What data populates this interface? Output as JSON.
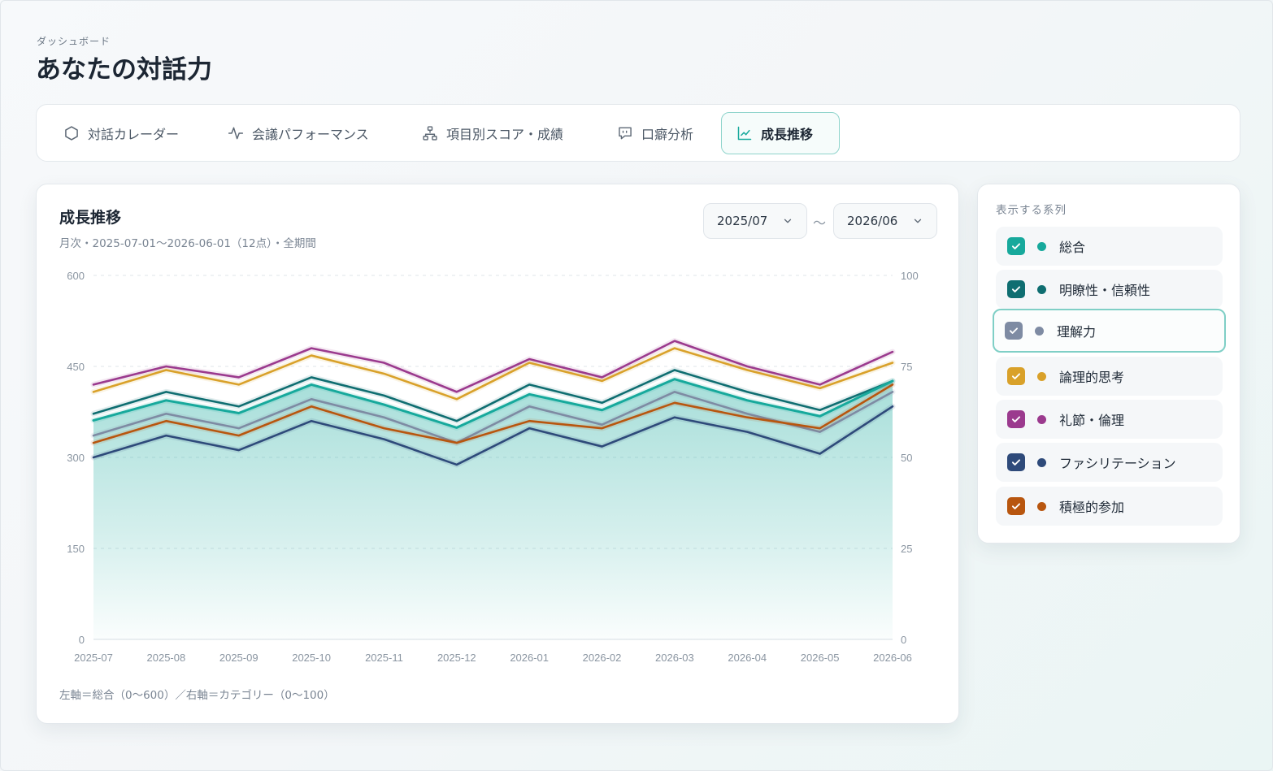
{
  "header": {
    "eyebrow": "ダッシュボード",
    "title": "あなたの対話力"
  },
  "tabs": [
    {
      "label": "対話カレーダー",
      "icon": "hexagon-icon",
      "active": false
    },
    {
      "label": "会議パフォーマンス",
      "icon": "pulse-icon",
      "active": false
    },
    {
      "label": "項目別スコア・成績",
      "icon": "hierarchy-icon",
      "active": false
    },
    {
      "label": "口癖分析",
      "icon": "speech-bubble-icon",
      "active": false
    },
    {
      "label": "成長推移",
      "icon": "line-chart-icon",
      "active": true
    }
  ],
  "card": {
    "title": "成長推移",
    "subtitle": "月次・2025-07-01〜2026-06-01（12点）・全期間",
    "range_from": "2025/07",
    "range_to": "2026/06",
    "range_sep": "〜",
    "footnote": "左軸＝総合（0〜600）／右軸＝カテゴリー（0〜100）"
  },
  "panel": {
    "title": "表示する系列",
    "items": [
      {
        "label": "総合",
        "color": "#17a99c",
        "checked": true
      },
      {
        "label": "明瞭性・信頼性",
        "color": "#0f6e71",
        "checked": true
      },
      {
        "label": "理解力",
        "color": "#7e8ba3",
        "checked": true
      },
      {
        "label": "論理的思考",
        "color": "#d9a12a",
        "checked": true
      },
      {
        "label": "礼節・倫理",
        "color": "#9b3a8e",
        "checked": true
      },
      {
        "label": "ファシリテーション",
        "color": "#2e4a7a",
        "checked": true
      },
      {
        "label": "積極的参加",
        "color": "#b8560f",
        "checked": true
      }
    ]
  },
  "chart_data": {
    "type": "line",
    "x": [
      "2025-07",
      "2025-08",
      "2025-09",
      "2025-10",
      "2025-11",
      "2025-12",
      "2026-01",
      "2026-02",
      "2026-03",
      "2026-04",
      "2026-05",
      "2026-06"
    ],
    "left_axis": {
      "min": 0,
      "max": 600,
      "ticks": [
        0,
        150,
        300,
        450,
        600
      ]
    },
    "right_axis": {
      "min": 0,
      "max": 100,
      "ticks": [
        0,
        25,
        50,
        75,
        100
      ]
    },
    "grid": true,
    "series": [
      {
        "name": "総合",
        "axis": "left",
        "color": "#17a99c",
        "area": true,
        "values": [
          361,
          394,
          373,
          420,
          387,
          349,
          404,
          378,
          429,
          394,
          368,
          426
        ]
      },
      {
        "name": "明瞭性・信頼性",
        "axis": "right",
        "color": "#0f6e71",
        "values": [
          62,
          68,
          64,
          72,
          67,
          60,
          70,
          65,
          74,
          68,
          63,
          71
        ]
      },
      {
        "name": "理解力",
        "axis": "right",
        "color": "#7e8ba3",
        "values": [
          56,
          62,
          58,
          66,
          61,
          54,
          64,
          59,
          68,
          62,
          57,
          68
        ]
      },
      {
        "name": "論理的思考",
        "axis": "right",
        "color": "#d9a12a",
        "values": [
          68,
          74,
          70,
          78,
          73,
          66,
          76,
          71,
          80,
          74,
          69,
          76
        ]
      },
      {
        "name": "礼節・倫理",
        "axis": "right",
        "color": "#9b3a8e",
        "values": [
          70,
          75,
          72,
          80,
          76,
          68,
          77,
          72,
          82,
          75,
          70,
          79
        ]
      },
      {
        "name": "ファシリテーション",
        "axis": "right",
        "color": "#2e4a7a",
        "values": [
          50,
          56,
          52,
          60,
          55,
          48,
          58,
          53,
          61,
          57,
          51,
          64
        ]
      },
      {
        "name": "積極的参加",
        "axis": "right",
        "color": "#b8560f",
        "values": [
          54,
          60,
          56,
          64,
          58,
          54,
          60,
          58,
          65,
          61,
          58,
          70
        ]
      }
    ]
  }
}
